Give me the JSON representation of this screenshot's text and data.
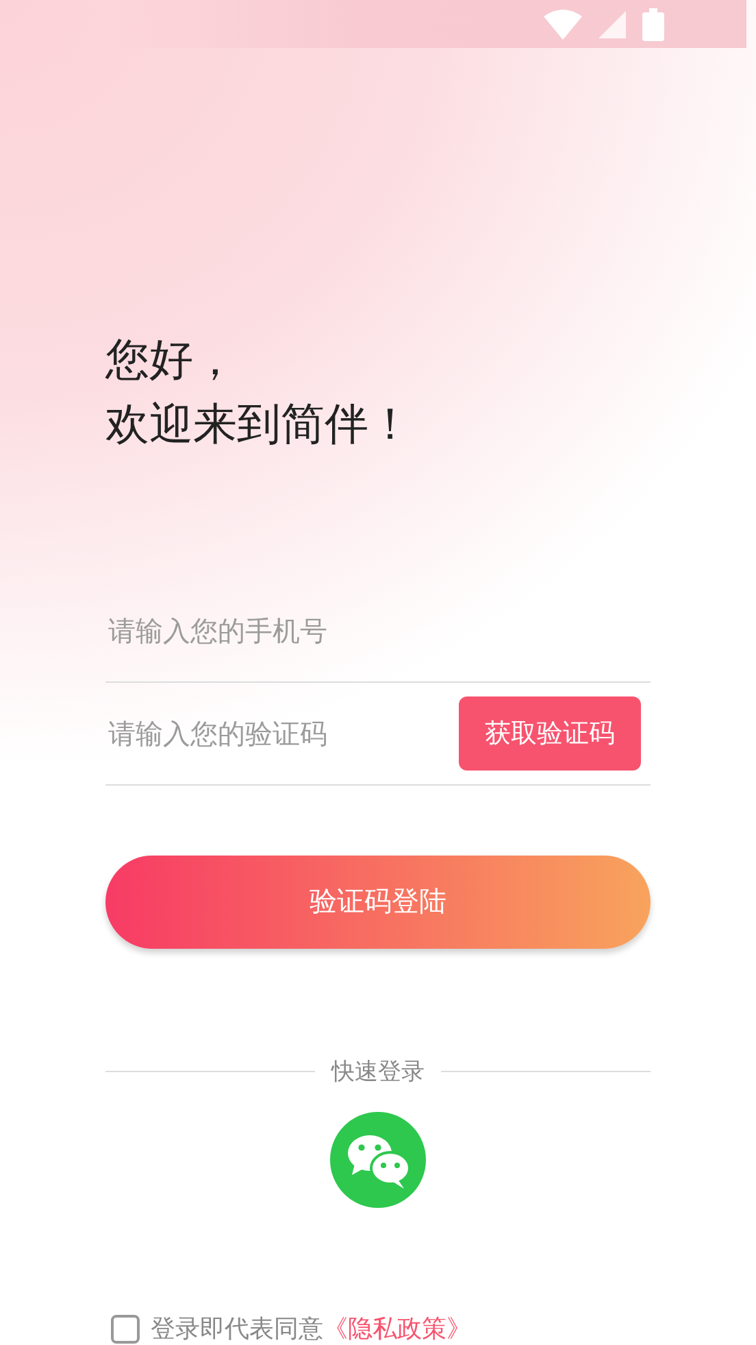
{
  "greeting": {
    "line_1": "您好，",
    "line_2": "欢迎来到简伴！"
  },
  "phone_field": {
    "placeholder": "请输入您的手机号"
  },
  "code_field": {
    "placeholder": "请输入您的验证码"
  },
  "get_code_button": "获取验证码",
  "login_button": "验证码登陆",
  "quick_login": {
    "label": "快速登录"
  },
  "agreement": {
    "checked": false,
    "text": "登录即代表同意",
    "link": "《隐私政策》"
  }
}
